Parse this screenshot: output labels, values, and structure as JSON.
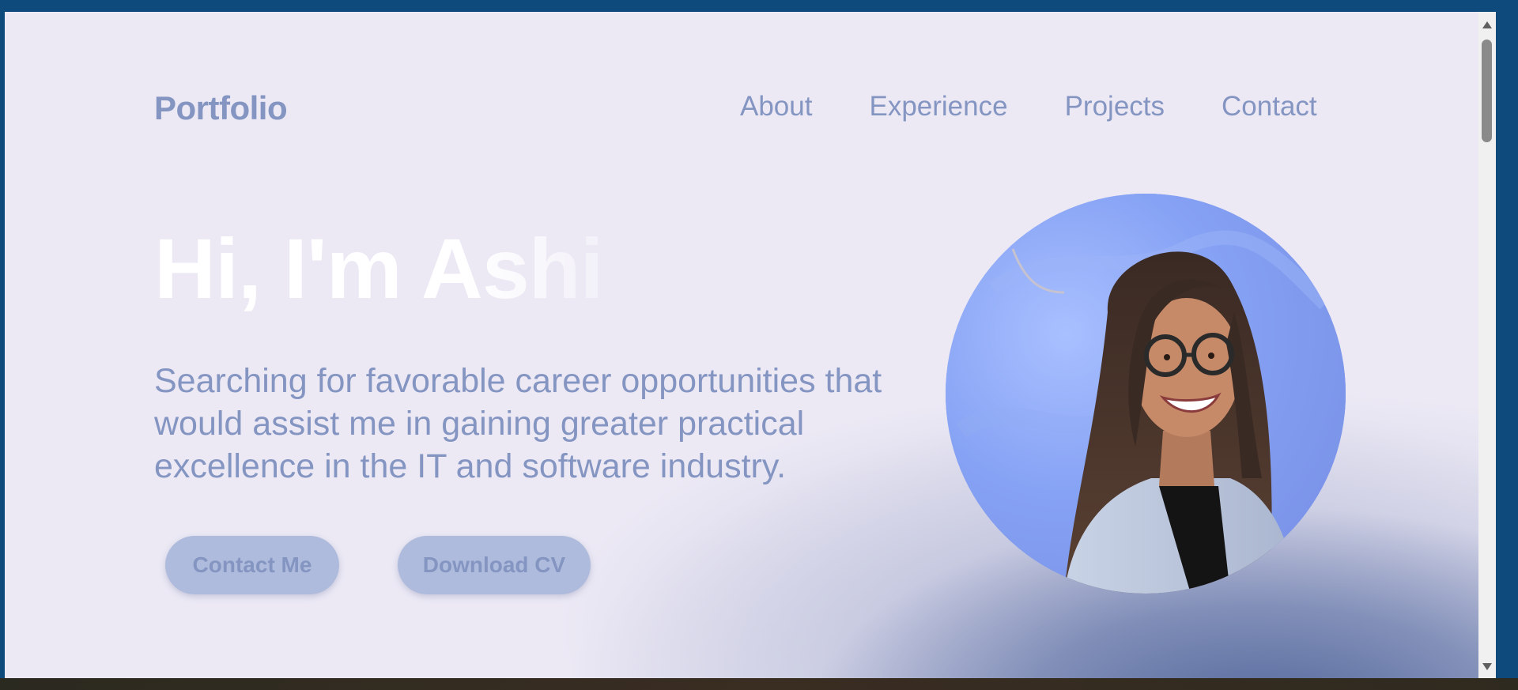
{
  "header": {
    "logo": "Portfolio",
    "nav": [
      "About",
      "Experience",
      "Projects",
      "Contact"
    ]
  },
  "hero": {
    "title": "Hi, I'm Ashi",
    "description": "Searching for favorable career opportunities that would assist me in gaining greater practical excellence in the IT and software industry.",
    "buttons": {
      "contact": "Contact Me",
      "download_cv": "Download CV"
    }
  },
  "colors": {
    "accent": "#8495c2",
    "button_bg": "#aebbdc",
    "page_bg": "#ece9f5",
    "frame": "#0e4a7c"
  }
}
